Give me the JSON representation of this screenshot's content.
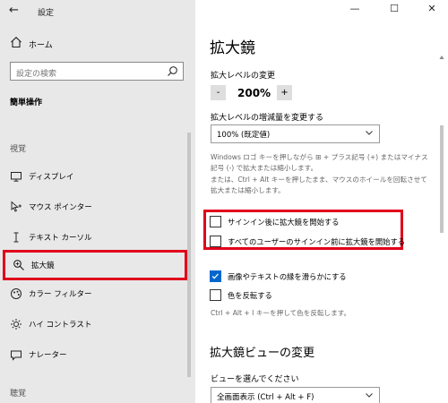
{
  "sidebar": {
    "back_glyph": "←",
    "title": "設定",
    "home_label": "ホーム",
    "search_placeholder": "設定の検索",
    "section_title": "簡単操作",
    "group_vision": "視覚",
    "group_hearing": "聴覚",
    "items": [
      {
        "label": "ディスプレイ",
        "icon": "display-icon"
      },
      {
        "label": "マウス ポインター",
        "icon": "mouse-pointer-icon"
      },
      {
        "label": "テキスト カーソル",
        "icon": "text-cursor-icon"
      },
      {
        "label": "拡大鏡",
        "icon": "magnifier-icon",
        "selected": true
      },
      {
        "label": "カラー フィルター",
        "icon": "color-filter-icon"
      },
      {
        "label": "ハイ コントラスト",
        "icon": "high-contrast-icon"
      },
      {
        "label": "ナレーター",
        "icon": "narrator-icon"
      }
    ]
  },
  "window": {
    "minimize": "—",
    "maximize": "☐",
    "close": "✕"
  },
  "main": {
    "title": "拡大鏡",
    "zoom_label": "拡大レベルの変更",
    "zoom_minus": "-",
    "zoom_value": "200%",
    "zoom_plus": "+",
    "increment_label": "拡大レベルの増減量を変更する",
    "increment_value": "100% (既定値)",
    "desc1_line1": "Windows ロゴ キーを押しながら ⊞ + プラス記号 (+) またはマイナス",
    "desc1_line2": "記号 (-) で拡大または縮小します。",
    "desc2_line1": "または、Ctrl + Alt キーを押したまま、マウスのホイールを回転させて",
    "desc2_line2": "拡大または縮小します。",
    "checkboxes": [
      {
        "label": "サインイン後に拡大鏡を開始する",
        "checked": false
      },
      {
        "label": "すべてのユーザーのサインイン前に拡大鏡を開始する",
        "checked": false
      },
      {
        "label": "画像やテキストの縁を滑らかにする",
        "checked": true
      },
      {
        "label": "色を反転する",
        "checked": false
      }
    ],
    "invert_hint": "Ctrl + Alt + I キーを押して色を反転します。",
    "view_heading": "拡大鏡ビューの変更",
    "view_label": "ビューを選んでください",
    "view_value": "全画面表示 (Ctrl + Alt + F)"
  },
  "colors": {
    "highlight": "#e0001b",
    "accent": "#0066cc",
    "sidebar_bg": "#e8e8e8"
  }
}
